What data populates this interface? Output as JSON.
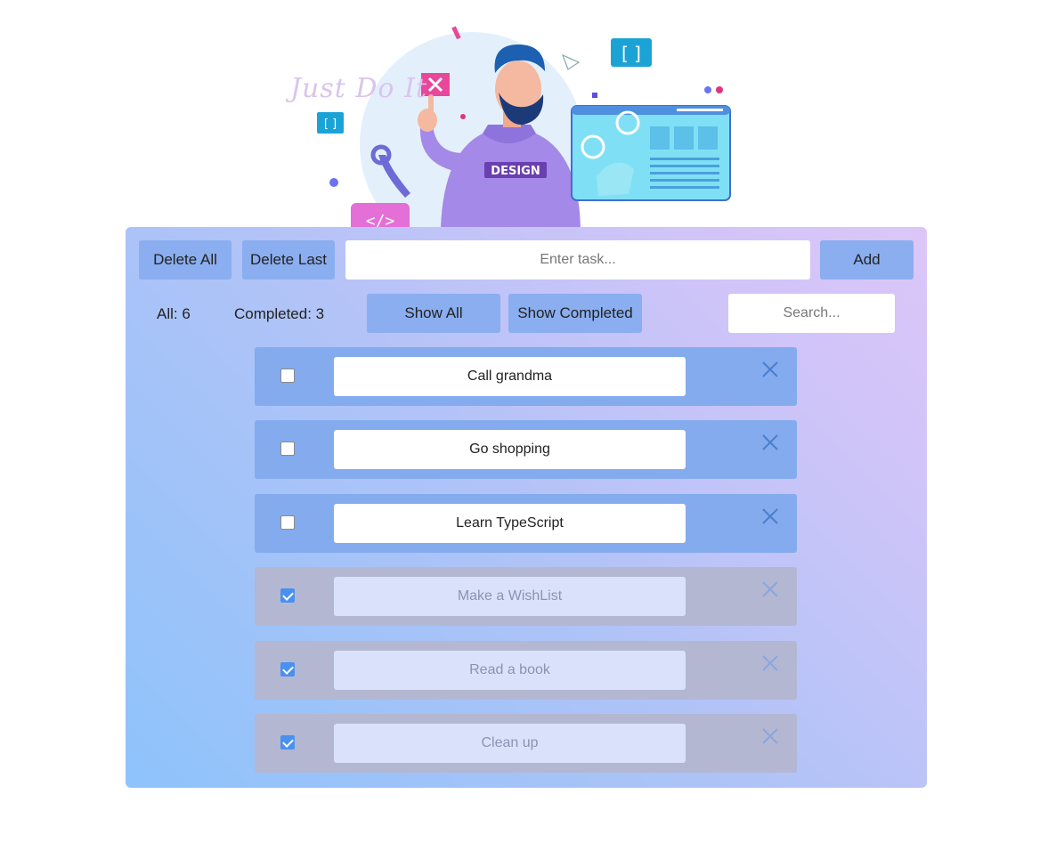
{
  "hero": {
    "caption": "Just Do It",
    "shirt_text": "DESIGN",
    "icon_left": "code-brackets-icon",
    "icon_top": "code-brackets-icon"
  },
  "toolbar": {
    "delete_all_label": "Delete All",
    "delete_last_label": "Delete Last",
    "task_input_placeholder": "Enter task...",
    "task_input_value": "",
    "add_label": "Add"
  },
  "filters": {
    "all_count_text": "All: 6",
    "completed_count_text": "Completed: 3",
    "show_all_label": "Show All",
    "show_completed_label": "Show Completed",
    "search_placeholder": "Search...",
    "search_value": ""
  },
  "tasks": [
    {
      "text": "Call grandma",
      "completed": false
    },
    {
      "text": "Go shopping",
      "completed": false
    },
    {
      "text": "Learn TypeScript",
      "completed": false
    },
    {
      "text": "Make a WishList",
      "completed": true
    },
    {
      "text": "Read a book",
      "completed": true
    },
    {
      "text": "Clean up",
      "completed": true
    }
  ],
  "colors": {
    "button": "#8aaef0",
    "task_active": "#83abee",
    "task_done": "#b3b7d2",
    "checkbox_checked": "#4a90f0",
    "remove_icon": "#4a7fd0"
  }
}
